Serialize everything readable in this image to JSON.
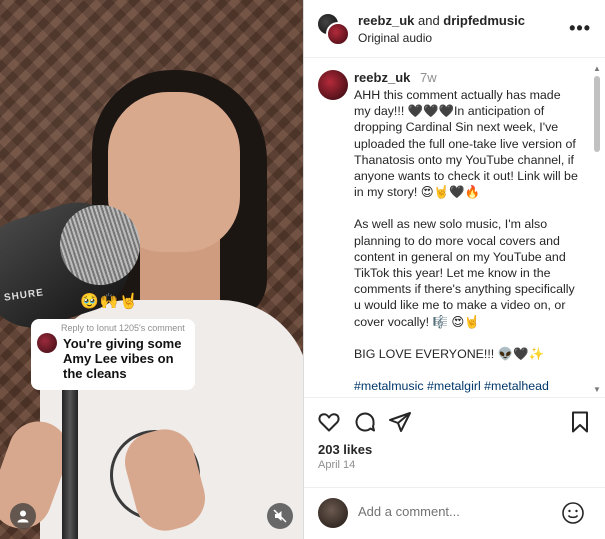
{
  "video": {
    "mic_brand": "SHURE",
    "emoji_reactions": "🥹🙌🤘",
    "reply_label": "Reply to Ionut 1205's comment",
    "reply_text": "You're giving some Amy Lee vibes on the cleans",
    "profile_icon": "person-icon",
    "mute_icon": "muted-speaker-icon"
  },
  "header": {
    "user1": "reebz_uk",
    "and": " and ",
    "user2": "dripfedmusic",
    "subtitle": "Original audio",
    "more_icon": "•••"
  },
  "caption": {
    "username": "reebz_uk",
    "time": "7w",
    "para1": "AHH this comment actually has made my day!!! 🖤🖤🖤In anticipation of dropping Cardinal Sin next week, I've uploaded the full one-take live version of Thanatosis onto my YouTube channel, if anyone wants to check it out! Link will be in my story! 😍🤘🖤🔥",
    "para2": "As well as new solo music, I'm also planning to do more vocal covers and content in general on my YouTube and TikTok this year! Let me know in the comments if there's anything specifically u would like me to make a video on, or cover vocally! 🎼 😍🤘",
    "para3": "BIG LOVE EVERYONE!!! 👽🖤✨",
    "tags": "#metalmusic #metalgirl #metalhead #metalvocalist #heavymusic #withyou"
  },
  "actions": {
    "like_icon": "heart-icon",
    "comment_icon": "comment-icon",
    "share_icon": "share-icon",
    "save_icon": "bookmark-icon"
  },
  "likes": "203 likes",
  "date": "April 14",
  "comment_box": {
    "placeholder": "Add a comment...",
    "emoji_icon": "smiley-icon"
  },
  "colors": {
    "link": "#00376b",
    "muted": "#8e8e8e",
    "text": "#262626"
  }
}
